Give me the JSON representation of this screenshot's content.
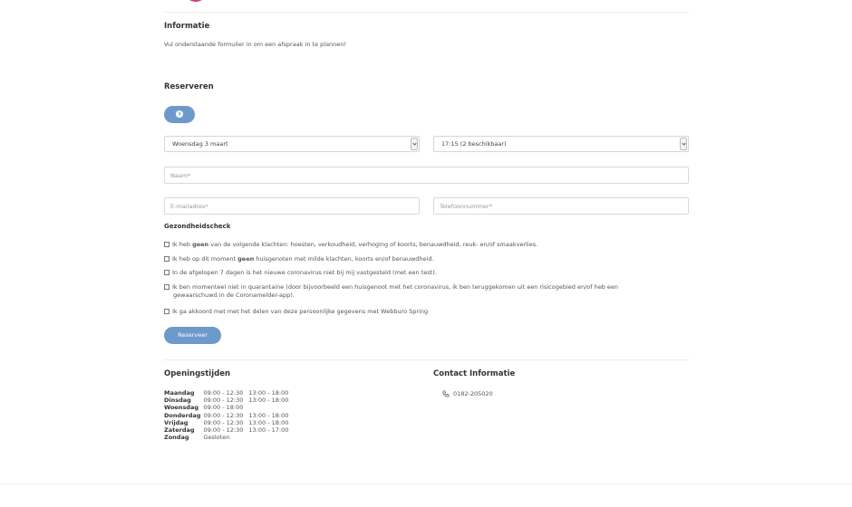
{
  "info": {
    "title": "Informatie",
    "text": "Vul onderstaande formulier in om een afspraak in te plannen!"
  },
  "reserve": {
    "title": "Reserveren",
    "date_select": "Woensdag 3 maart",
    "time_select": "17:15 (2 beschikbaar)",
    "name_placeholder": "Naam*",
    "email_placeholder": "E-mailadres*",
    "phone_placeholder": "Telefoonnummer*"
  },
  "health": {
    "title": "Gezondheidscheck",
    "items": [
      {
        "pre": "Ik heb ",
        "bold": "geen",
        "post": " van de volgende klachten: hoesten, verkoudheid, verhoging of koorts, benauwdheid, reuk- en/of smaakverlies."
      },
      {
        "pre": "Ik heb op dit moment ",
        "bold": "geen",
        "post": " huisgenoten met milde klachten, koorts en/of benauwdheid."
      },
      {
        "pre": "In de afgelopen 7 dagen is het nieuwe coronavirus niet bij mij vastgesteld (met een test).",
        "bold": "",
        "post": ""
      },
      {
        "pre": "Ik ben momenteel niet in quarantaine (door bijvoorbeeld een huisgenoot met het coronavirus, ik ben teruggekomen uit een risicogebied en/of heb een",
        "bold": "",
        "post": "",
        "line2": "gewaarschuwd in de Coronamelder-app)."
      },
      {
        "pre": "Ik ga akkoord met met het delen van deze persoonlijke gegevens met Webburo Spring",
        "bold": "",
        "post": ""
      }
    ],
    "submit_label": "Reserveer"
  },
  "hours": {
    "title": "Openingstijden",
    "rows": [
      {
        "day": "Maandag",
        "t1": "09:00 - 12:30",
        "t2": "13:00 - 18:00"
      },
      {
        "day": "Dinsdag",
        "t1": "09:00 - 12:30",
        "t2": "13:00 - 18:00"
      },
      {
        "day": "Woensdag",
        "t1": "09:00 - 18:00",
        "t2": ""
      },
      {
        "day": "Donderdag",
        "t1": "09:00 - 12:30",
        "t2": "13:00 - 18:00"
      },
      {
        "day": "Vrijdag",
        "t1": "09:00 - 12:30",
        "t2": "13:00 - 18:00"
      },
      {
        "day": "Zaterdag",
        "t1": "09:00 - 12:30",
        "t2": "13:00 - 17:00"
      },
      {
        "day": "Zondag",
        "t1": "Gesloten",
        "t2": ""
      }
    ]
  },
  "contact": {
    "title": "Contact Informatie",
    "phone": "0182-205020",
    "phone_icon": "phone-icon"
  },
  "colors": {
    "accent": "#6e99cb",
    "logo": "#d63a8c"
  }
}
